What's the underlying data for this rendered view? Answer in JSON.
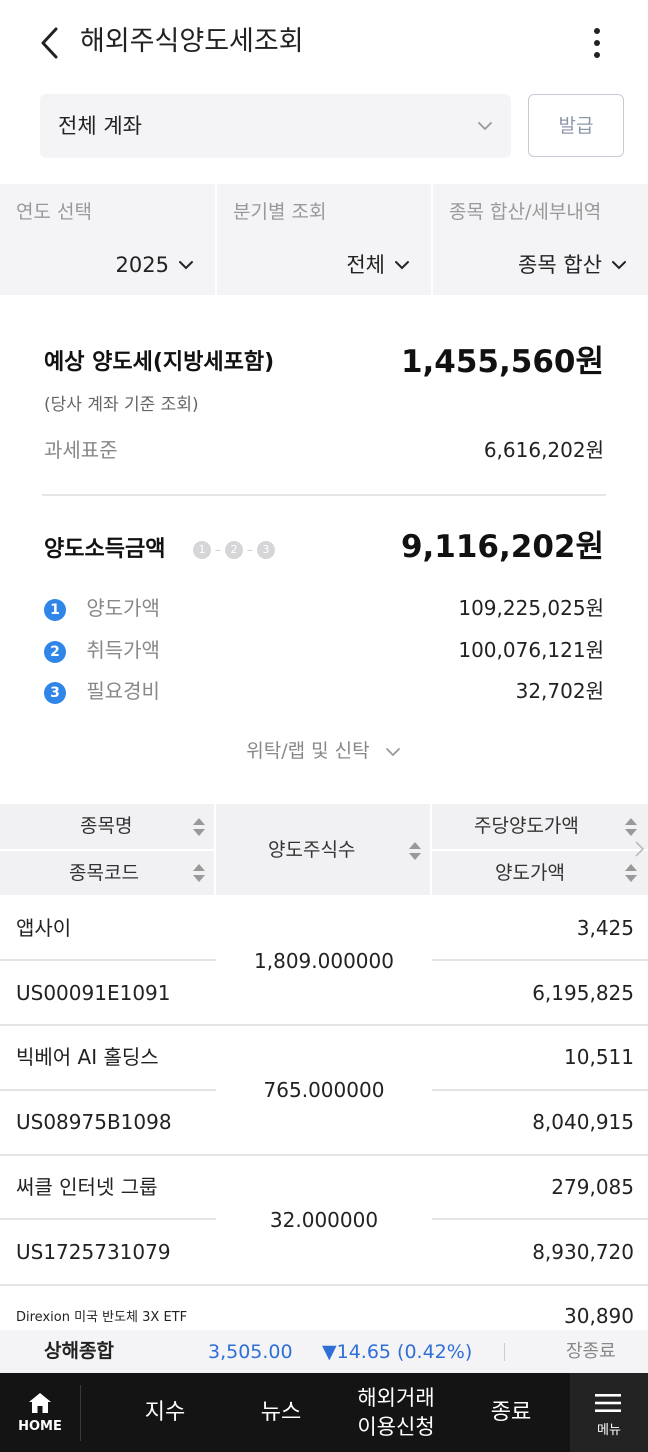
{
  "header": {
    "title": "해외주식양도세조회"
  },
  "account": {
    "selected": "전체 계좌",
    "issue_button": "발급"
  },
  "filters": [
    {
      "label": "연도 선택",
      "value": "2025"
    },
    {
      "label": "분기별 조회",
      "value": "전체"
    },
    {
      "label": "종목 합산/세부내역",
      "value": "종목 합산"
    }
  ],
  "summary": {
    "tax_title": "예상 양도세(지방세포함)",
    "tax_value": "1,455,560원",
    "tax_note": "(당사 계좌 기준 조회)",
    "base_label": "과세표준",
    "base_value": "6,616,202원",
    "income_title": "양도소득금액",
    "income_steps": [
      "1",
      "2",
      "3"
    ],
    "income_value": "9,116,202원",
    "items": [
      {
        "num": "1",
        "label": "양도가액",
        "value": "109,225,025원"
      },
      {
        "num": "2",
        "label": "취득가액",
        "value": "100,076,121원"
      },
      {
        "num": "3",
        "label": "필요경비",
        "value": "32,702원"
      }
    ],
    "trust_toggle": "위탁/랩 및 신탁"
  },
  "table": {
    "headers": {
      "name": "종목명",
      "code": "종목코드",
      "qty": "양도주식수",
      "price": "주당양도가액",
      "amount": "양도가액"
    },
    "rows": [
      {
        "name": "앱사이",
        "code": "US00091E1091",
        "qty": "1,809.000000",
        "price": "3,425",
        "amount": "6,195,825"
      },
      {
        "name": "빅베어 AI 홀딩스",
        "code": "US08975B1098",
        "qty": "765.000000",
        "price": "10,511",
        "amount": "8,040,915"
      },
      {
        "name": "써클 인터넷 그룹",
        "code": "US1725731079",
        "qty": "32.000000",
        "price": "279,085",
        "amount": "8,930,720"
      },
      {
        "name": "Direxion 미국 반도체 3X ETF",
        "price": "30,890"
      }
    ]
  },
  "ticker": {
    "name": "상해종합",
    "value": "3,505.00",
    "change": "▼14.65 (0.42%)",
    "status": "장종료"
  },
  "nav": {
    "home": "HOME",
    "items": [
      "지수",
      "뉴스",
      "해외거래\n이용신청",
      "종료"
    ],
    "menu": "메뉴"
  },
  "colors": {
    "accent_blue": "#2f86e8",
    "down_blue": "#2f6fd8",
    "nav_bg": "#141414"
  }
}
